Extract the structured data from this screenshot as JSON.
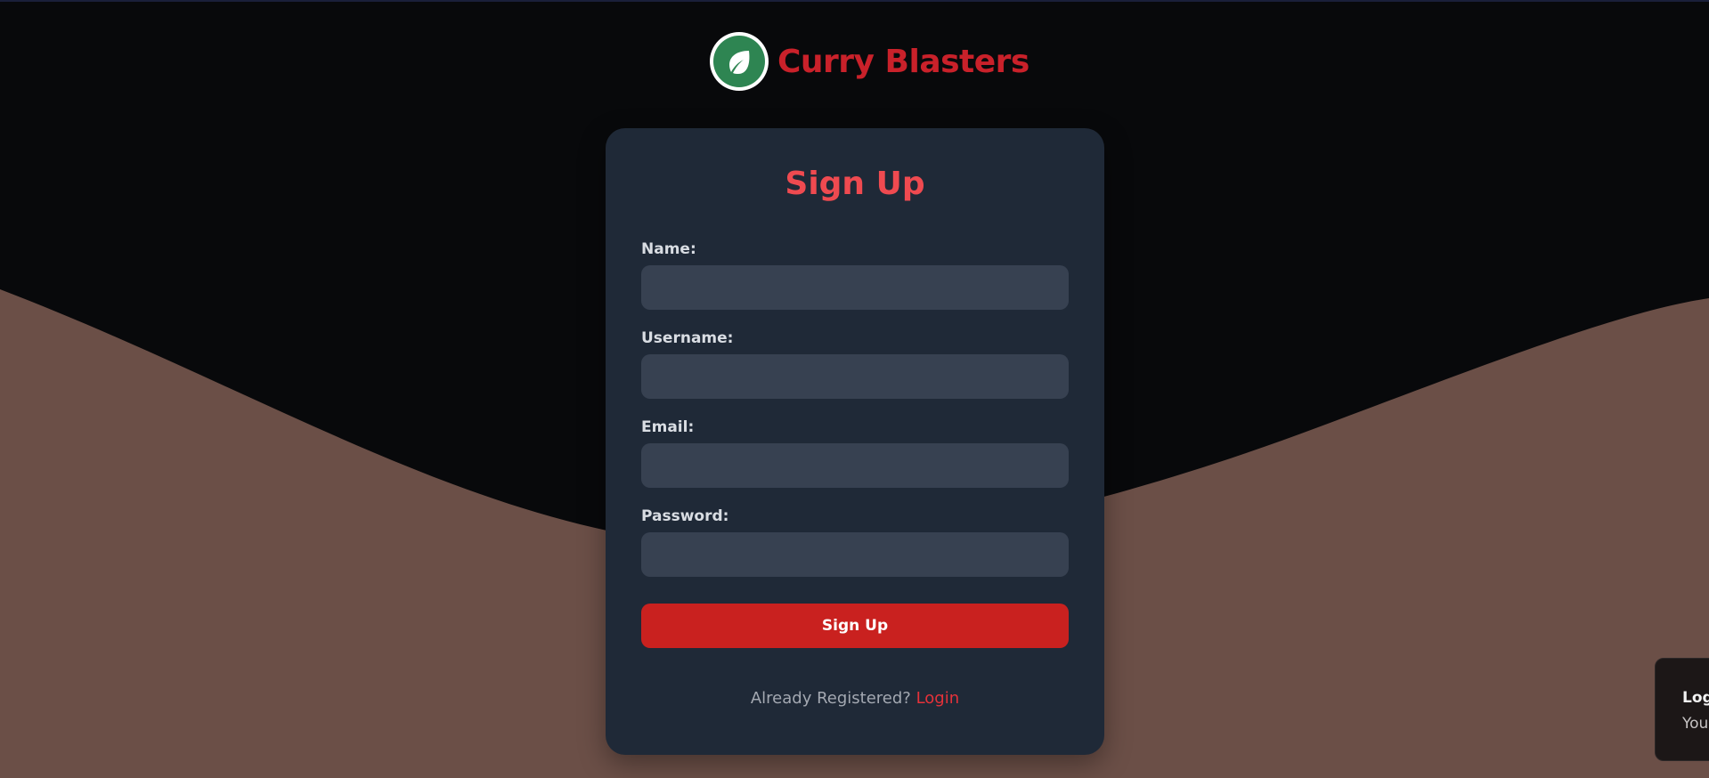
{
  "brand": {
    "name": "Curry Blasters",
    "logo_icon": "leaf-icon",
    "color": "#c9212a"
  },
  "signup": {
    "title": "Sign Up",
    "fields": [
      {
        "label": "Name:",
        "value": "",
        "placeholder": ""
      },
      {
        "label": "Username:",
        "value": "",
        "placeholder": ""
      },
      {
        "label": "Email:",
        "value": "",
        "placeholder": ""
      },
      {
        "label": "Password:",
        "value": "",
        "placeholder": ""
      }
    ],
    "submit_label": "Sign Up",
    "footer_text": "Already Registered?",
    "login_link": "Login"
  },
  "toast": {
    "title": "Log",
    "message": "You"
  },
  "colors": {
    "background": "#08090b",
    "wave": "#6b4f47",
    "card": "#1f2937",
    "input": "#374151",
    "accent": "#c9211f",
    "title": "#ef4a50"
  }
}
